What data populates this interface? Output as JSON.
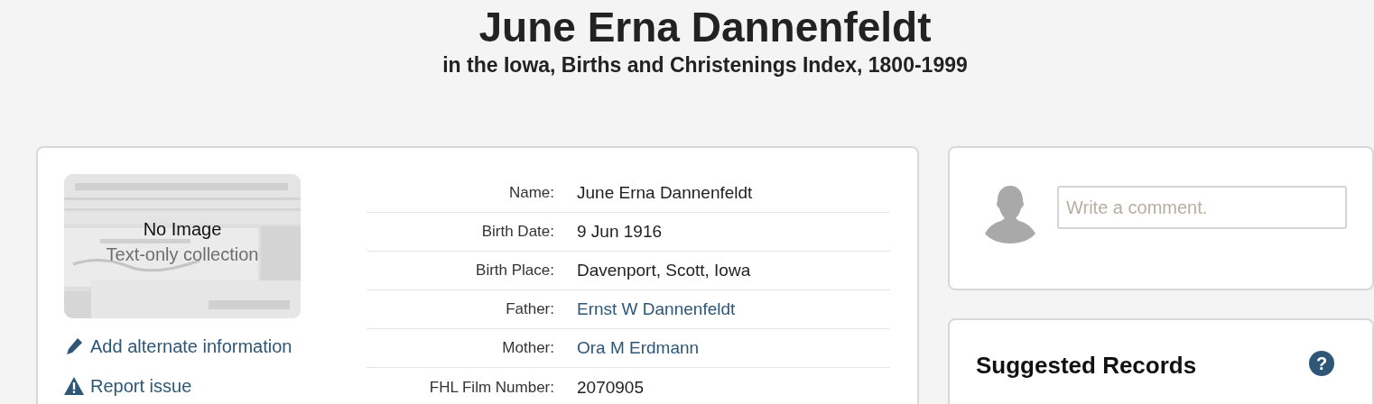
{
  "header": {
    "title": "June Erna Dannenfeldt",
    "subtitle": "in the Iowa, Births and Christenings Index, 1800-1999"
  },
  "record": {
    "thumbnail": {
      "caption": "No Image",
      "note": "Text-only collection"
    },
    "actions": [
      {
        "kind": "edit",
        "label": "Add alternate information"
      },
      {
        "kind": "warning",
        "label": "Report issue"
      }
    ],
    "fields": [
      {
        "label": "Name:",
        "value": "June Erna Dannenfeldt",
        "kind": "text"
      },
      {
        "label": "Birth Date:",
        "value": "9 Jun 1916",
        "kind": "text"
      },
      {
        "label": "Birth Place:",
        "value": "Davenport, Scott, Iowa",
        "kind": "text"
      },
      {
        "label": "Father:",
        "value": "Ernst W Dannenfeldt",
        "kind": "link"
      },
      {
        "label": "Mother:",
        "value": "Ora M Erdmann",
        "kind": "link"
      },
      {
        "label": "FHL Film Number:",
        "value": "2070905",
        "kind": "text"
      }
    ]
  },
  "comment": {
    "placeholder": "Write a comment."
  },
  "suggested": {
    "title": "Suggested Records",
    "help": "?"
  }
}
